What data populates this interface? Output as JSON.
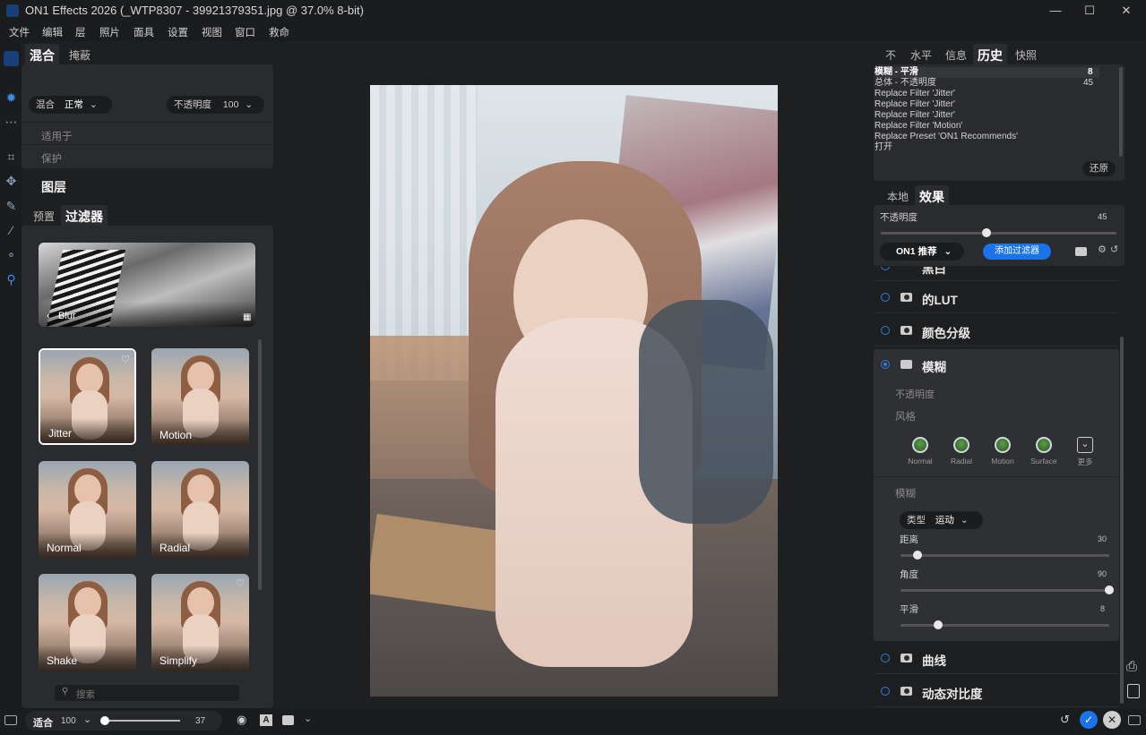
{
  "app": {
    "title": "ON1 Effects 2026 (_WTP8307 - 39921379351.jpg @ 37.0% 8-bit)"
  },
  "window": {
    "min": "—",
    "max": "☐",
    "close": "✕"
  },
  "menu": [
    "文件",
    "编辑",
    "层",
    "照片",
    "面具",
    "设置",
    "视图",
    "窗口",
    "救命"
  ],
  "left": {
    "tabs": [
      "混合",
      "掩蔽"
    ],
    "blend_label": "混合",
    "blend_value": "正常",
    "opacity_label": "不透明度",
    "opacity_value": "100",
    "apply_to": "适用于",
    "protect": "保护",
    "layers_title": "图层",
    "subtabs": [
      "预置",
      "过滤器"
    ],
    "category": "Blur",
    "filters": [
      "Jitter",
      "Motion",
      "Normal",
      "Radial",
      "Shake",
      "Simplify"
    ],
    "search_placeholder": "搜索"
  },
  "right": {
    "tabs": [
      "不",
      "水平",
      "信息",
      "历史",
      "快照"
    ],
    "history_top": "模糊 - 平滑",
    "history_top_num": "8",
    "history_second": "总体 - 不透明度",
    "history_second_num": "45",
    "history": [
      "Replace Filter 'Jitter'",
      "Replace Filter 'Jitter'",
      "Replace Filter 'Jitter'",
      "Replace Filter 'Motion'",
      "Replace Preset 'ON1 Recommends'",
      "打开"
    ],
    "restore": "还原",
    "subtabs": [
      "本地",
      "效果"
    ],
    "opacity_label": "不透明度",
    "opacity_value": "45",
    "opacity_level": 0.45,
    "preset_btn": "ON1 推荐",
    "add_filter": "添加过滤器",
    "partial_row": "黑白",
    "fx": [
      "的LUT",
      "颜色分级",
      "模糊"
    ],
    "fx_opacity": "不透明度",
    "style_title": "风格",
    "styles": [
      "Normal",
      "Radial",
      "Motion",
      "Surface",
      "更多"
    ],
    "blur_title": "模糊",
    "type_label": "类型",
    "type_value": "运动",
    "distance_label": "距离",
    "distance_value": "30",
    "distance_level": 0.08,
    "angle_label": "角度",
    "angle_value": "90",
    "angle_level": 1.0,
    "smooth_label": "平滑",
    "smooth_value": "8",
    "smooth_level": 0.18,
    "fx_bottom": [
      "曲线",
      "动态对比度"
    ]
  },
  "bottom": {
    "fit": "适合",
    "zoom": "100",
    "zoom2": "37"
  }
}
